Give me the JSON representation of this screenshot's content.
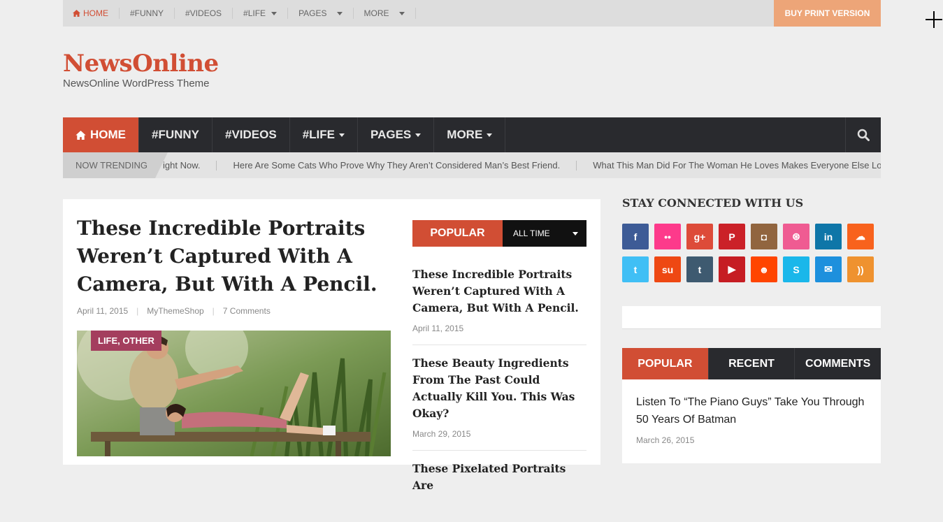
{
  "topbar": {
    "items": [
      "Home",
      "#Funny",
      "#Videos",
      "#Life",
      "Pages",
      "More"
    ],
    "buy_label": "Buy Print Version"
  },
  "header": {
    "site_title": "NewsOnline",
    "tagline": "NewsOnline WordPress Theme"
  },
  "nav": {
    "items": [
      "Home",
      "#Funny",
      "#Videos",
      "#Life",
      "Pages",
      "More"
    ]
  },
  "trending": {
    "label": "Now Trending",
    "items": [
      "ight Now.",
      "Here Are Some Cats Who Prove Why They Aren’t Considered Man’s Best Friend.",
      "What This Man Did For The Woman He Loves Makes Everyone Else Look B"
    ]
  },
  "post": {
    "title": "These Incredible Portraits Weren’t Captured With A Camera, But With A Pencil.",
    "date": "April 11, 2015",
    "author": "MyThemeShop",
    "comments": "7 Comments",
    "category": "Life, Other"
  },
  "popular": {
    "tab": "Popular",
    "filter": "All Time",
    "items": [
      {
        "title": "These Incredible Portraits Weren’t Captured With A Camera, But With A Pencil.",
        "date": "April 11, 2015"
      },
      {
        "title": "These Beauty Ingredients From The Past Could Actually Kill You. This Was Okay?",
        "date": "March 29, 2015"
      },
      {
        "title": "These Pixelated Portraits Are",
        "date": ""
      }
    ]
  },
  "sidebar": {
    "title": "Stay Connected With Us",
    "social": [
      {
        "icon": "facebook-icon",
        "glyph": "f",
        "color": "#3d5b96"
      },
      {
        "icon": "flickr-icon",
        "glyph": "••",
        "color": "#fd3a8b"
      },
      {
        "icon": "google-plus-icon",
        "glyph": "g+",
        "color": "#dd4b39"
      },
      {
        "icon": "pinterest-icon",
        "glyph": "P",
        "color": "#cb2128"
      },
      {
        "icon": "instagram-icon",
        "glyph": "◘",
        "color": "#91653f"
      },
      {
        "icon": "dribbble-icon",
        "glyph": "⊛",
        "color": "#ef5b92"
      },
      {
        "icon": "linkedin-icon",
        "glyph": "in",
        "color": "#0e76a8"
      },
      {
        "icon": "soundcloud-icon",
        "glyph": "☁",
        "color": "#f8621d"
      },
      {
        "icon": "twitter-icon",
        "glyph": "t",
        "color": "#40bff5"
      },
      {
        "icon": "stumbleupon-icon",
        "glyph": "su",
        "color": "#ee4813"
      },
      {
        "icon": "tumblr-icon",
        "glyph": "t",
        "color": "#3e5a70"
      },
      {
        "icon": "youtube-icon",
        "glyph": "▶",
        "color": "#c61d23"
      },
      {
        "icon": "reddit-icon",
        "glyph": "☻",
        "color": "#ff4500"
      },
      {
        "icon": "skype-icon",
        "glyph": "S",
        "color": "#1ab7ea"
      },
      {
        "icon": "email-icon",
        "glyph": "✉",
        "color": "#1d90dd"
      },
      {
        "icon": "rss-icon",
        "glyph": "))",
        "color": "#ef922f"
      }
    ],
    "tabs": [
      "Popular",
      "Recent",
      "Comments"
    ],
    "tab_item": {
      "title": "Listen To “The Piano Guys” Take You Through 50 Years Of Batman",
      "date": "March 26, 2015"
    }
  },
  "colors": {
    "accent": "#d14e34",
    "dark": "#292a2e",
    "buy": "#eda578",
    "category": "#a43e5e"
  }
}
